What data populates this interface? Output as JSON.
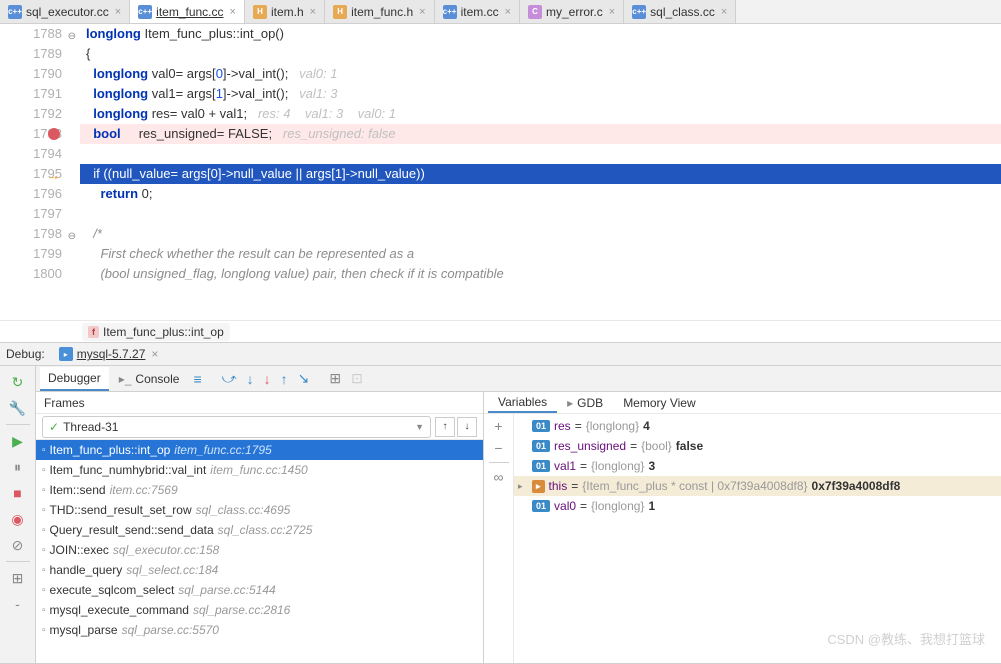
{
  "tabs": [
    {
      "name": "sql_executor.cc",
      "type": "cc",
      "active": false
    },
    {
      "name": "item_func.cc",
      "type": "cc",
      "active": true
    },
    {
      "name": "item.h",
      "type": "h",
      "active": false
    },
    {
      "name": "item_func.h",
      "type": "h",
      "active": false
    },
    {
      "name": "item.cc",
      "type": "cc",
      "active": false
    },
    {
      "name": "my_error.c",
      "type": "c",
      "active": false
    },
    {
      "name": "sql_class.cc",
      "type": "cc",
      "active": false
    }
  ],
  "editor": {
    "lines": [
      {
        "num": "1788",
        "html": "<span class='kw'>longlong</span> Item_func_plus::int_op()",
        "collapse": true
      },
      {
        "num": "1789",
        "html": "{"
      },
      {
        "num": "1790",
        "html": "  <span class='kw'>longlong</span> val0= args[<span class='num'>0</span>]->val_int();   <span class='comment-hint'>val0: 1</span>"
      },
      {
        "num": "1791",
        "html": "  <span class='kw'>longlong</span> val1= args[<span class='num'>1</span>]->val_int();   <span class='comment-hint'>val1: 3</span>"
      },
      {
        "num": "1792",
        "html": "  <span class='kw'>longlong</span> res= val0 + val1;   <span class='comment-hint'>res: 4    val1: 3    val0: 1</span>"
      },
      {
        "num": "1793",
        "html": "  <span class='kw'>bool</span>     res_unsigned= FALSE;   <span class='comment-hint'>res_unsigned: false</span>",
        "breakpoint": true,
        "bpline": true
      },
      {
        "num": "1794",
        "html": ""
      },
      {
        "num": "1795",
        "html": "  if ((null_value= args[0]->null_value || args[1]->null_value))",
        "arrow": true,
        "highlighted": true
      },
      {
        "num": "1796",
        "html": "    <span class='kw'>return</span> 0;"
      },
      {
        "num": "1797",
        "html": ""
      },
      {
        "num": "1798",
        "html": "  <span class='comment'>/*</span>",
        "collapse": true
      },
      {
        "num": "1799",
        "html": "    <span class='comment'>First check whether the result can be represented as a</span>"
      },
      {
        "num": "1800",
        "html": "    <span class='comment'>(bool unsigned_flag, longlong value) pair, then check if it is compatible</span>"
      }
    ],
    "breadcrumb": "Item_func_plus::int_op"
  },
  "debug": {
    "label": "Debug:",
    "config": "mysql-5.7.27",
    "tabs": {
      "debugger": "Debugger",
      "console": "Console"
    },
    "frames_label": "Frames",
    "thread": "Thread-31",
    "frames": [
      {
        "name": "Item_func_plus::int_op",
        "loc": "item_func.cc:1795",
        "selected": true
      },
      {
        "name": "Item_func_numhybrid::val_int",
        "loc": "item_func.cc:1450"
      },
      {
        "name": "Item::send",
        "loc": "item.cc:7569"
      },
      {
        "name": "THD::send_result_set_row",
        "loc": "sql_class.cc:4695"
      },
      {
        "name": "Query_result_send::send_data",
        "loc": "sql_class.cc:2725"
      },
      {
        "name": "JOIN::exec",
        "loc": "sql_executor.cc:158"
      },
      {
        "name": "handle_query",
        "loc": "sql_select.cc:184"
      },
      {
        "name": "execute_sqlcom_select",
        "loc": "sql_parse.cc:5144"
      },
      {
        "name": "mysql_execute_command",
        "loc": "sql_parse.cc:2816"
      },
      {
        "name": "mysql_parse",
        "loc": "sql_parse.cc:5570"
      }
    ],
    "var_tabs": {
      "variables": "Variables",
      "gdb": "GDB",
      "memory": "Memory View"
    },
    "vars": [
      {
        "badge": "01",
        "name": "res",
        "type": "{longlong}",
        "val": "4"
      },
      {
        "badge": "01",
        "name": "res_unsigned",
        "type": "{bool}",
        "val": "false"
      },
      {
        "badge": "01",
        "name": "val1",
        "type": "{longlong}",
        "val": "3"
      },
      {
        "badge": "",
        "name": "this",
        "type": "{Item_func_plus * const | 0x7f39a4008df8}",
        "val": "0x7f39a4008df8",
        "selected": true,
        "expandable": true,
        "ptr": true
      },
      {
        "badge": "01",
        "name": "val0",
        "type": "{longlong}",
        "val": "1"
      }
    ]
  },
  "watermark": "CSDN @教练、我想打篮球"
}
